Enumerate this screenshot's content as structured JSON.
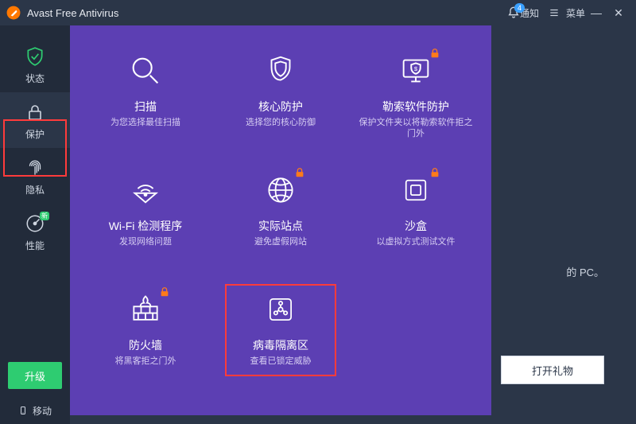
{
  "titlebar": {
    "app_title": "Avast Free Antivirus",
    "notify_label": "通知",
    "notify_count": "4",
    "menu_label": "菜单"
  },
  "sidebar": {
    "status_label": "状态",
    "protect_label": "保护",
    "privacy_label": "隐私",
    "perf_label": "性能",
    "perf_badge": "新",
    "upgrade_label": "升级",
    "mobile_label": "移动"
  },
  "panel": {
    "scan": {
      "label": "扫描",
      "desc": "为您选择最佳扫描"
    },
    "core": {
      "label": "核心防护",
      "desc": "选择您的核心防御"
    },
    "ransom": {
      "label": "勒索软件防护",
      "desc": "保护文件夹以将勒索软件拒之门外"
    },
    "wifi": {
      "label": "Wi-Fi 检测程序",
      "desc": "发现网络问题"
    },
    "realsite": {
      "label": "实际站点",
      "desc": "避免虚假网站"
    },
    "sandbox": {
      "label": "沙盒",
      "desc": "以虚拟方式测试文件"
    },
    "firewall": {
      "label": "防火墙",
      "desc": "将黑客拒之门外"
    },
    "quarantine": {
      "label": "病毒隔离区",
      "desc": "查看已锁定威胁"
    }
  },
  "main": {
    "bg_text_suffix": "的 PC。",
    "gift_button": "打开礼物"
  }
}
